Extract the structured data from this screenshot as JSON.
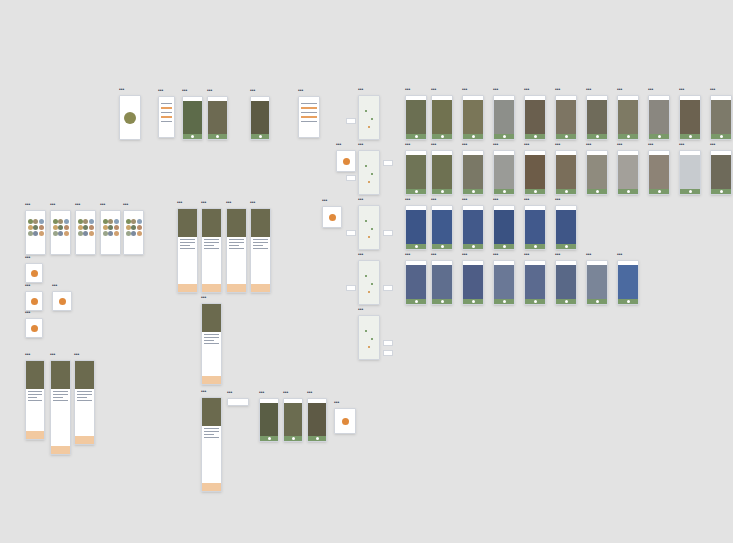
{
  "canvas": {
    "frames": [
      {
        "label": "•••",
        "kind": "splash"
      },
      {
        "label": "•••",
        "kind": "list"
      },
      {
        "label": "•••",
        "kind": "photo",
        "color": "#5d6b4a"
      },
      {
        "label": "•••",
        "kind": "photo",
        "color": "#6d6a52"
      },
      {
        "label": "•••",
        "kind": "photo",
        "color": "#5c5a44"
      },
      {
        "label": "•••",
        "kind": "list"
      },
      {
        "label": "•••",
        "kind": "map"
      },
      {
        "label": "•••",
        "kind": "map"
      },
      {
        "label": "•••",
        "kind": "map"
      },
      {
        "label": "•••",
        "kind": "map"
      },
      {
        "label": "•••",
        "kind": "map"
      },
      {
        "label": "•••",
        "kind": "photo",
        "color": "#6b6f52"
      },
      {
        "label": "•••",
        "kind": "photo",
        "color": "#717250"
      },
      {
        "label": "•••",
        "kind": "photo",
        "color": "#7a7658"
      },
      {
        "label": "•••",
        "kind": "photo",
        "color": "#8d8f8a"
      },
      {
        "label": "•••",
        "kind": "photo",
        "color": "#6a5f4e"
      },
      {
        "label": "•••",
        "kind": "photo",
        "color": "#7d7563"
      },
      {
        "label": "•••",
        "kind": "photo",
        "color": "#6f6b5a"
      },
      {
        "label": "•••",
        "kind": "photo",
        "color": "#7e7a64"
      },
      {
        "label": "•••",
        "kind": "photo",
        "color": "#8a8780"
      },
      {
        "label": "•••",
        "kind": "photo",
        "color": "#6c6250"
      },
      {
        "label": "•••",
        "kind": "photo",
        "color": "#7d7a6a"
      },
      {
        "label": "•••",
        "kind": "photo",
        "color": "#6f7456"
      },
      {
        "label": "•••",
        "kind": "photo",
        "color": "#6e7152"
      },
      {
        "label": "•••",
        "kind": "photo",
        "color": "#7a7866"
      },
      {
        "label": "•••",
        "kind": "photo",
        "color": "#9a9b97"
      },
      {
        "label": "•••",
        "kind": "photo",
        "color": "#6d5c48"
      },
      {
        "label": "•••",
        "kind": "photo",
        "color": "#7a6e5a"
      },
      {
        "label": "•••",
        "kind": "photo",
        "color": "#8f8b7e"
      },
      {
        "label": "•••",
        "kind": "photo",
        "color": "#a3a09a"
      },
      {
        "label": "•••",
        "kind": "photo",
        "color": "#8d8376"
      },
      {
        "label": "•••",
        "kind": "photo",
        "color": "#c7cbcf"
      },
      {
        "label": "•••",
        "kind": "photo",
        "color": "#6e6a5a"
      },
      {
        "label": "•••",
        "kind": "photo",
        "color": "#3c5588"
      },
      {
        "label": "•••",
        "kind": "photo",
        "color": "#3f5a8e"
      },
      {
        "label": "•••",
        "kind": "photo",
        "color": "#42598a"
      },
      {
        "label": "•••",
        "kind": "photo",
        "color": "#3a5282"
      },
      {
        "label": "•••",
        "kind": "photo",
        "color": "#41598c"
      },
      {
        "label": "•••",
        "kind": "photo",
        "color": "#3f5687"
      },
      {
        "label": "•••",
        "kind": "photo",
        "color": "#55648a"
      },
      {
        "label": "•••",
        "kind": "photo",
        "color": "#5f6e8e"
      },
      {
        "label": "•••",
        "kind": "photo",
        "color": "#4e5d86"
      },
      {
        "label": "•••",
        "kind": "photo",
        "color": "#6a7896"
      },
      {
        "label": "•••",
        "kind": "photo",
        "color": "#5b6a8f"
      },
      {
        "label": "•••",
        "kind": "photo",
        "color": "#596887"
      },
      {
        "label": "•••",
        "kind": "photo",
        "color": "#7a8598"
      },
      {
        "label": "•••",
        "kind": "photo",
        "color": "#4b6aa0"
      },
      {
        "label": "•••",
        "kind": "palette"
      },
      {
        "label": "•••",
        "kind": "palette"
      },
      {
        "label": "•••",
        "kind": "palette"
      },
      {
        "label": "•••",
        "kind": "palette"
      },
      {
        "label": "•••",
        "kind": "palette"
      },
      {
        "label": "•••",
        "kind": "card"
      },
      {
        "label": "•••",
        "kind": "card"
      },
      {
        "label": "•••",
        "kind": "card"
      },
      {
        "label": "•••",
        "kind": "card"
      },
      {
        "label": "•••",
        "kind": "article"
      },
      {
        "label": "•••",
        "kind": "article"
      },
      {
        "label": "•••",
        "kind": "article"
      },
      {
        "label": "•••",
        "kind": "article"
      },
      {
        "label": "•••",
        "kind": "article"
      },
      {
        "label": "•••",
        "kind": "article"
      },
      {
        "label": "•••",
        "kind": "article"
      },
      {
        "label": "•••",
        "kind": "article"
      },
      {
        "label": "•••",
        "kind": "article"
      },
      {
        "label": "•••",
        "kind": "photo",
        "color": "#5a5e45"
      },
      {
        "label": "•••",
        "kind": "photo",
        "color": "#6b6c50"
      },
      {
        "label": "•••",
        "kind": "photo",
        "color": "#5e5a45"
      },
      {
        "label": "•••",
        "kind": "card"
      },
      {
        "label": "•••",
        "kind": "note"
      },
      {
        "label": "•••",
        "kind": "card"
      },
      {
        "label": "•••",
        "kind": "card"
      }
    ]
  }
}
